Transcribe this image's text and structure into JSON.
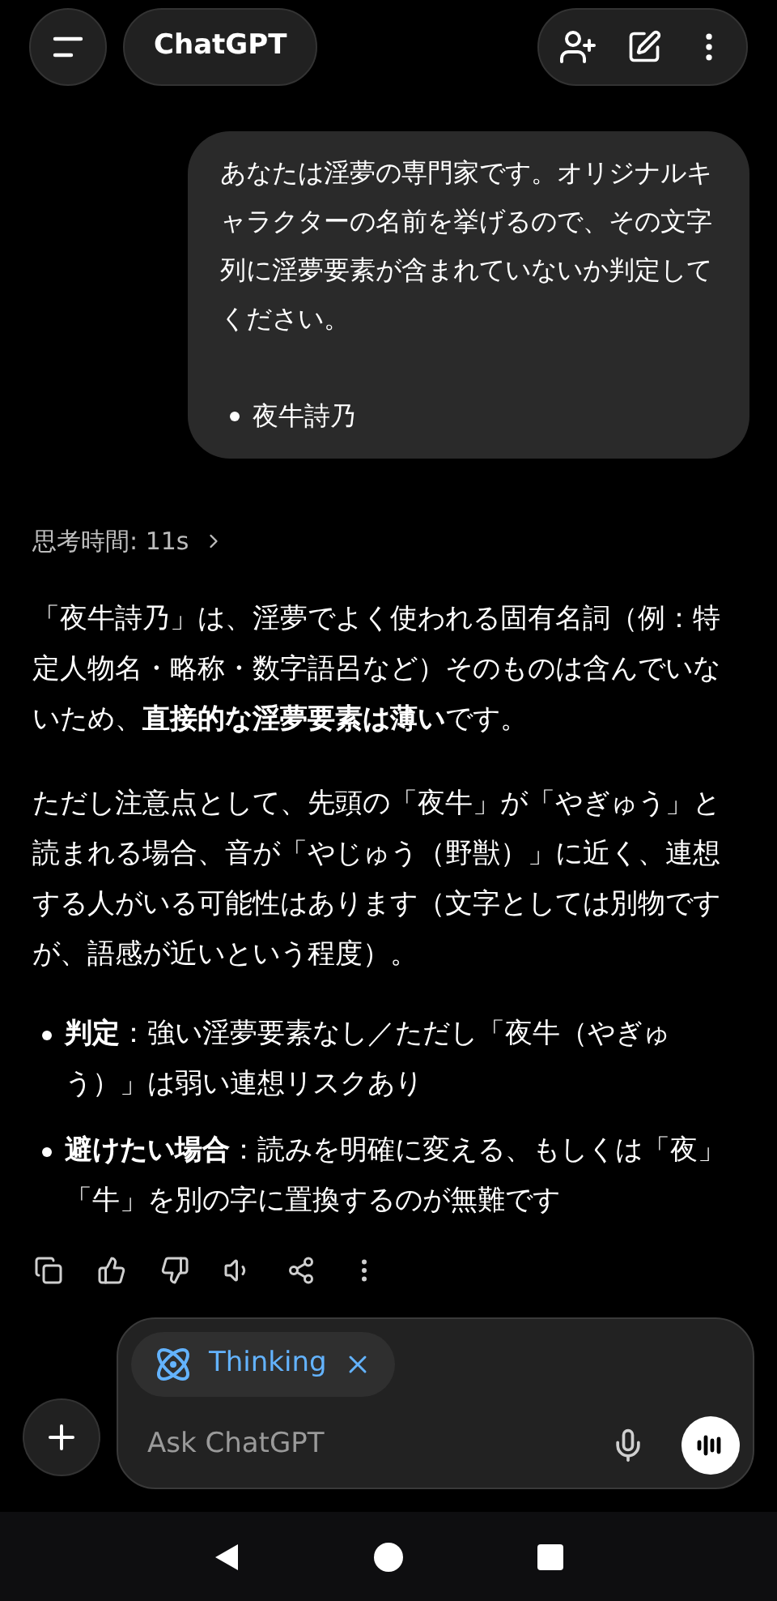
{
  "header": {
    "title": "ChatGPT"
  },
  "user_message": {
    "text": "あなたは淫夢の専門家です。オリジナルキャラクターの名前を挙げるので、その文字列に淫夢要素が含まれていないか判定してください。",
    "bullets": [
      "夜牛詩乃"
    ]
  },
  "response": {
    "thinking_time": "思考時間: 11s",
    "thinking_expanded": false,
    "paragraphs": [
      "「夜牛詩乃」は、淫夢でよく使われる固有名詞（例：特定人物名・略称・数字語呂など）そのものは含んでいないため、**直接的な淫夢要素は薄い**です。",
      "ただし注意点として、先頭の「夜牛」が「やぎゅう」と読まれる場合、音が「やじゅう（野獣）」に近く、連想する人がいる可能性はあります（文字としては別物ですが、語感が近いという程度）。"
    ],
    "bullets": [
      "**判定**：強い淫夢要素なし／ただし「夜牛（やぎゅう）」は弱い連想リスクあり",
      "**避けたい場合**：読みを明確に変える、もしくは「夜」「牛」を別の字に置換するのが無難です"
    ]
  },
  "composer": {
    "chip": "Thinking",
    "placeholder": "Ask ChatGPT"
  }
}
